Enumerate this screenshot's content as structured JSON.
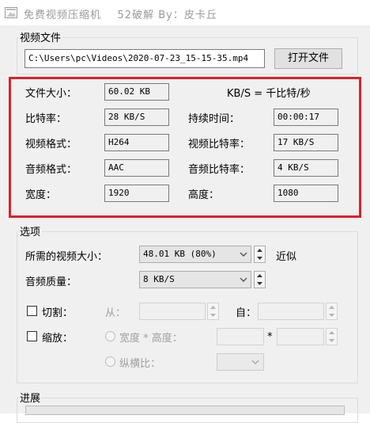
{
  "window": {
    "title": "免费视频压缩机    52破解 By：皮卡丘"
  },
  "video_file": {
    "group_label": "视频文件",
    "path": "C:\\Users\\pc\\Videos\\2020-07-23_15-15-35.mp4",
    "open_button": "打开文件"
  },
  "info": {
    "file_size_label": "文件大小：",
    "file_size": "60.02 KB",
    "unit_note": "KB/S = 千比特/秒",
    "bitrate_label": "比特率：",
    "bitrate": "28 KB/S",
    "duration_label": "持续时间：",
    "duration": "00:00:17",
    "video_format_label": "视频格式：",
    "video_format": "H264",
    "video_bitrate_label": "视频比特率：",
    "video_bitrate": "17 KB/S",
    "audio_format_label": "音频格式：",
    "audio_format": "AAC",
    "audio_bitrate_label": "音频比特率：",
    "audio_bitrate": "4 KB/S",
    "width_label": "宽度：",
    "width": "1920",
    "height_label": "高度：",
    "height": "1080"
  },
  "options": {
    "group_label": "选项",
    "target_size_label": "所需的视频大小：",
    "target_size": "48.01 KB (80%)",
    "approx_label": "近似",
    "audio_quality_label": "音频质量：",
    "audio_quality": "8 KB/S",
    "cut_label": "切割：",
    "cut_checked": false,
    "from_label": "从：",
    "to_label": "自：",
    "scale_label": "缩放：",
    "scale_checked": false,
    "width_height_label": "宽度 * 高度：",
    "times_sign": "*",
    "aspect_label": "纵横比："
  },
  "progress": {
    "group_label": "进展"
  },
  "colors": {
    "highlight_border": "#d9232a",
    "panel_bg": "#f0f0f0"
  }
}
